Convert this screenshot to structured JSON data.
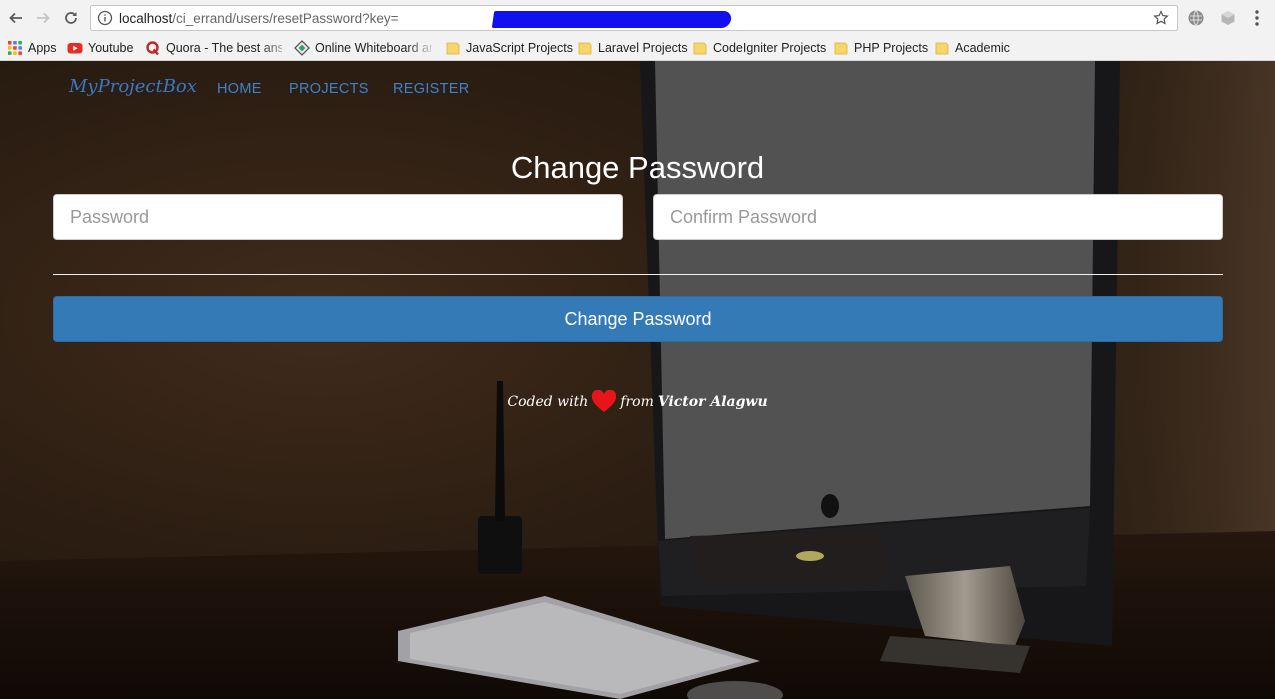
{
  "browser": {
    "url_host": "localhost",
    "url_path": "/ci_errand/users/resetPassword?key=",
    "bookmarks": [
      {
        "label": "Apps",
        "icon": "apps-grid-icon"
      },
      {
        "label": "Youtube",
        "icon": "youtube-icon"
      },
      {
        "label": "Quora - The best answ",
        "icon": "quora-icon"
      },
      {
        "label": "Online Whiteboard an",
        "icon": "whiteboard-icon"
      },
      {
        "label": "JavaScript Projects",
        "icon": "folder-icon"
      },
      {
        "label": "Laravel Projects",
        "icon": "folder-icon"
      },
      {
        "label": "CodeIgniter Projects",
        "icon": "folder-icon"
      },
      {
        "label": "PHP Projects",
        "icon": "folder-icon"
      },
      {
        "label": "Academic",
        "icon": "folder-icon"
      }
    ]
  },
  "site": {
    "brand": "MyProjectBox",
    "nav": [
      "HOME",
      "PROJECTS",
      "REGISTER"
    ]
  },
  "form": {
    "title": "Change Password",
    "password_placeholder": "Password",
    "confirm_placeholder": "Confirm Password",
    "submit_label": "Change Password"
  },
  "footer": {
    "prefix": "Coded with",
    "middle": "from",
    "author": "Victor Alagwu"
  },
  "colors": {
    "accent": "#337ab7",
    "nav_link": "#3d82cc",
    "heart": "#e8141b"
  }
}
